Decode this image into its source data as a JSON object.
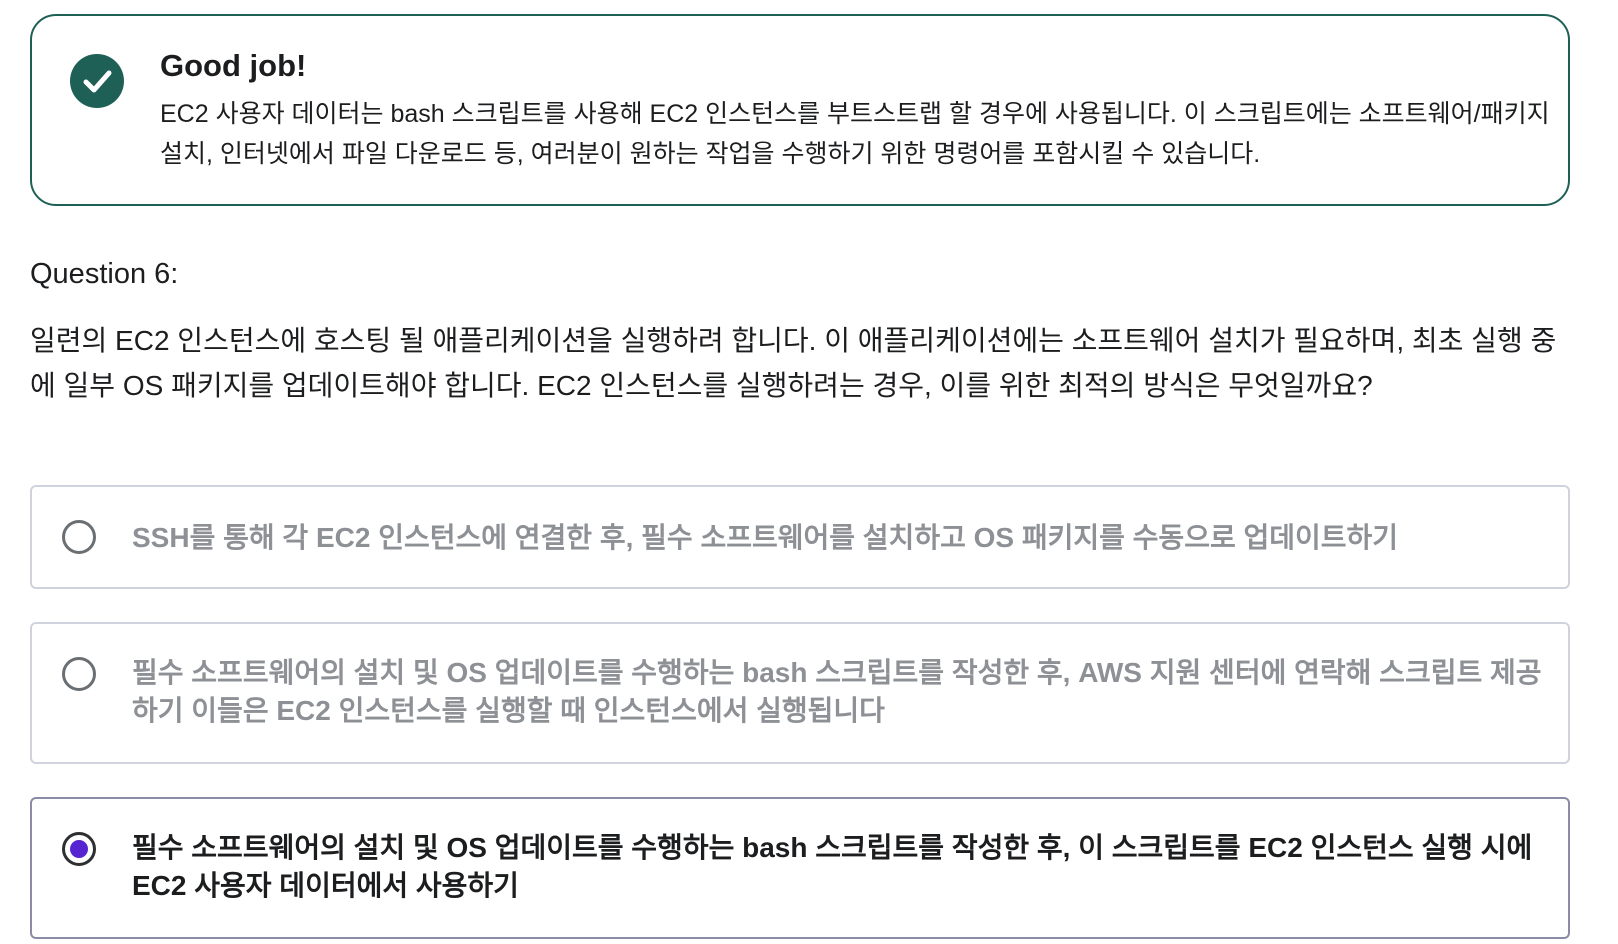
{
  "feedback": {
    "icon": "check-circle-icon",
    "accent_color": "#1e6055",
    "title": "Good job!",
    "text": "EC2 사용자 데이터는 bash 스크립트를 사용해 EC2 인스턴스를 부트스트랩 할 경우에 사용됩니다. 이 스크립트에는 소프트웨어/패키지 설치, 인터넷에서 파일 다운로드 등, 여러분이 원하는 작업을 수행하기 위한 명령어를 포함시킬 수 있습니다."
  },
  "question": {
    "label": "Question 6:",
    "text": "일련의 EC2 인스턴스에 호스팅 될 애플리케이션을 실행하려 합니다. 이 애플리케이션에는 소프트웨어 설치가 필요하며, 최초 실행 중에 일부 OS 패키지를 업데이트해야 합니다. EC2 인스턴스를 실행하려는 경우, 이를 위한 최적의 방식은 무엇일까요?"
  },
  "options": [
    {
      "text": "SSH를 통해 각 EC2 인스턴스에 연결한 후, 필수 소프트웨어를 설치하고 OS 패키지를 수동으로 업데이트하기",
      "selected": false
    },
    {
      "text": "필수 소프트웨어의 설치 및 OS 업데이트를 수행하는 bash 스크립트를 작성한 후, AWS 지원 센터에 연락해 스크립트 제공하기 이들은 EC2 인스턴스를 실행할 때 인스턴스에서 실행됩니다",
      "selected": false
    },
    {
      "text": "필수 소프트웨어의 설치 및 OS 업데이트를 수행하는 bash 스크립트를 작성한 후, 이 스크립트를 EC2 인스턴스 실행 시에 EC2 사용자 데이터에서 사용하기",
      "selected": true
    }
  ],
  "colors": {
    "selected_radio": "#5624d0",
    "unselected_text": "#8d9095"
  }
}
